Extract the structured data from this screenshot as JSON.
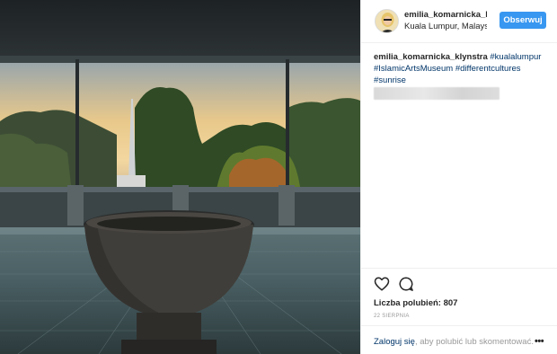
{
  "post": {
    "username": "emilia_komarnicka_klynstra",
    "location": "Kuala Lumpur, Malaysia",
    "follow_label": "Obserwuj",
    "photo_description": "Sunrise view through museum window with stone fountain basin"
  },
  "caption": {
    "author": "emilia_komarnicka_klynstra",
    "hashtags": [
      "#kualalumpur",
      "#IslamicArtsMuseum",
      "#differentcultures",
      "#sunrise"
    ]
  },
  "stats": {
    "likes_label": "Liczba polubień: 807",
    "date": "22 SIERPNIA"
  },
  "footer": {
    "login_link": "Zaloguj się",
    "login_rest": ", aby polubić lub skomentować.",
    "more_label": "•••"
  },
  "icons": {
    "heart": "heart-icon",
    "comment": "comment-icon",
    "more": "more-options-icon"
  },
  "colors": {
    "accent": "#3897f0",
    "link": "#003569",
    "muted": "#999999"
  }
}
